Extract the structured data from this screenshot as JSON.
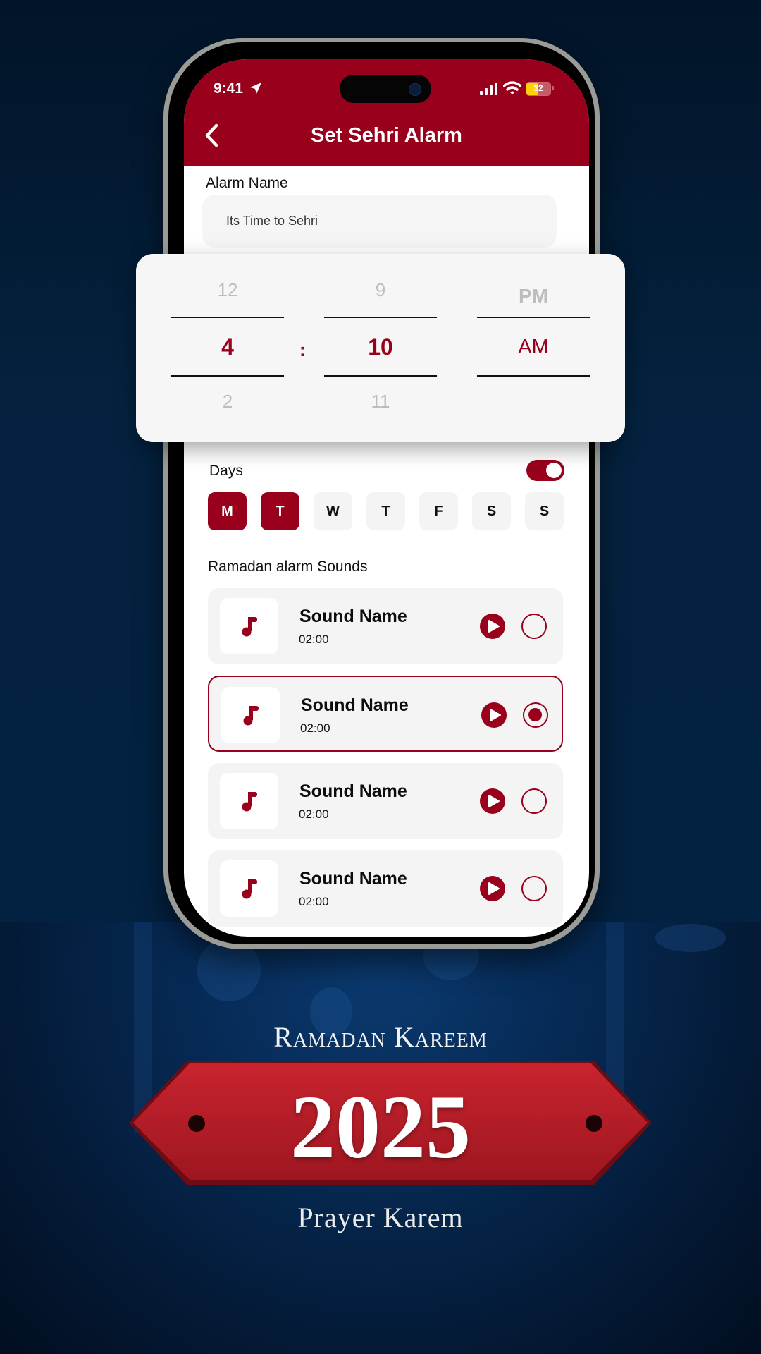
{
  "status_bar": {
    "time": "9:41",
    "battery": "32"
  },
  "header": {
    "title": "Set Sehri Alarm",
    "back_icon": "chevron-left-icon"
  },
  "alarm_name": {
    "label": "Alarm Name",
    "value": "Its Time to Sehri"
  },
  "time_picker": {
    "hour": {
      "prev": "12",
      "selected": "4",
      "next": "2"
    },
    "separator": ":",
    "minute": {
      "prev": "9",
      "selected": "10",
      "next": "11"
    },
    "period": {
      "prev": "PM",
      "selected": "AM",
      "next": ""
    }
  },
  "days": {
    "label": "Days",
    "toggle_on": true,
    "items": [
      {
        "label": "M",
        "selected": true
      },
      {
        "label": "T",
        "selected": true
      },
      {
        "label": "W",
        "selected": false
      },
      {
        "label": "T",
        "selected": false
      },
      {
        "label": "F",
        "selected": false
      },
      {
        "label": "S",
        "selected": false
      },
      {
        "label": "S",
        "selected": false
      }
    ]
  },
  "sounds": {
    "label": "Ramadan alarm Sounds",
    "items": [
      {
        "name": "Sound Name",
        "duration": "02:00",
        "selected": false
      },
      {
        "name": "Sound Name",
        "duration": "02:00",
        "selected": true
      },
      {
        "name": "Sound Name",
        "duration": "02:00",
        "selected": false
      },
      {
        "name": "Sound Name",
        "duration": "02:00",
        "selected": false
      }
    ]
  },
  "promo": {
    "headline": "Ramadan Kareem",
    "year": "2025",
    "tagline": "Prayer Karem"
  },
  "colors": {
    "accent": "#98001b",
    "background": "#031529",
    "banner": "#b81f2a"
  }
}
